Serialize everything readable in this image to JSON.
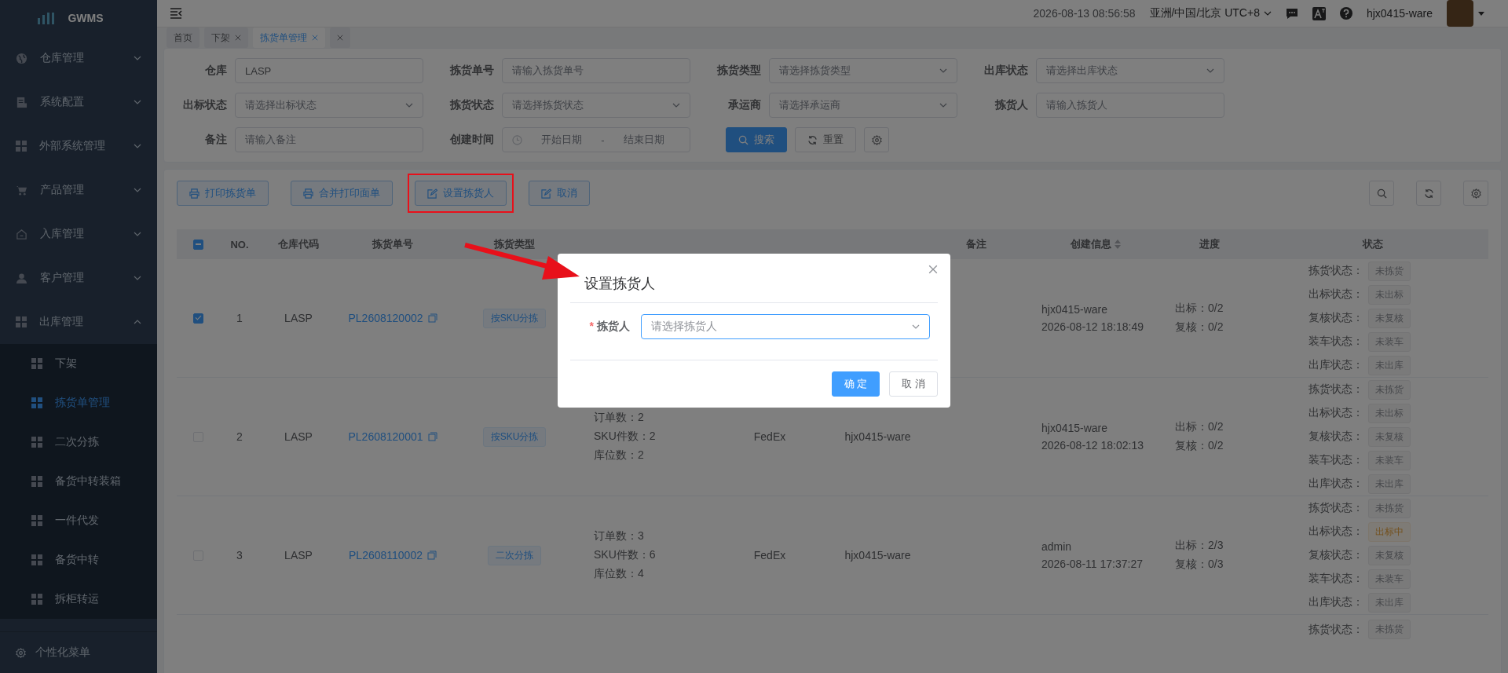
{
  "sidebar": {
    "logo": "GWMS",
    "items": [
      {
        "label": "仓库管理",
        "expanded": false
      },
      {
        "label": "系统配置",
        "expanded": false
      },
      {
        "label": "外部系统管理",
        "expanded": false
      },
      {
        "label": "产品管理",
        "expanded": false
      },
      {
        "label": "入库管理",
        "expanded": false
      },
      {
        "label": "客户管理",
        "expanded": false
      },
      {
        "label": "出库管理",
        "expanded": true,
        "children": [
          {
            "label": "下架",
            "selected": false
          },
          {
            "label": "拣货单管理",
            "selected": true
          },
          {
            "label": "二次分拣",
            "selected": false
          },
          {
            "label": "备货中转装箱",
            "selected": false
          },
          {
            "label": "一件代发",
            "selected": false
          },
          {
            "label": "备货中转",
            "selected": false
          },
          {
            "label": "拆柜转运",
            "selected": false
          }
        ]
      }
    ],
    "footer": "个性化菜单"
  },
  "header": {
    "datetime": "2026-08-13 08:56:58",
    "timezone": "亚洲/中国/北京 UTC+8",
    "user": "hjx0415-ware"
  },
  "tabs": [
    {
      "label": "首页",
      "closable": false,
      "selected": false
    },
    {
      "label": "下架",
      "closable": true,
      "selected": false
    },
    {
      "label": "拣货单管理",
      "closable": true,
      "selected": true
    },
    {
      "closable": true,
      "selected": false
    }
  ],
  "filters": [
    {
      "label": "仓库",
      "kind": "text",
      "value": "LASP"
    },
    {
      "label": "拣货单号",
      "kind": "text",
      "placeholder": "请输入拣货单号"
    },
    {
      "label": "拣货类型",
      "kind": "select",
      "placeholder": "请选择拣货类型"
    },
    {
      "label": "出库状态",
      "kind": "select",
      "placeholder": "请选择出库状态"
    },
    {
      "label": "出标状态",
      "kind": "select",
      "placeholder": "请选择出标状态"
    },
    {
      "label": "拣货状态",
      "kind": "select",
      "placeholder": "请选择拣货状态"
    },
    {
      "label": "承运商",
      "kind": "select",
      "placeholder": "请选择承运商"
    },
    {
      "label": "拣货人",
      "kind": "text",
      "placeholder": "请输入拣货人"
    },
    {
      "label": "备注",
      "kind": "text",
      "placeholder": "请输入备注"
    },
    {
      "label": "创建时间",
      "kind": "daterange",
      "start_placeholder": "开始日期",
      "separator": "-",
      "end_placeholder": "结束日期"
    }
  ],
  "filter_buttons": {
    "search": "搜索",
    "reset": "重置"
  },
  "toolbar": [
    {
      "label": "打印拣货单",
      "kind": "print",
      "annotated": false
    },
    {
      "label": "合并打印面单",
      "kind": "print",
      "annotated": false
    },
    {
      "label": "设置拣货人",
      "kind": "edit",
      "annotated": true
    },
    {
      "label": "取消",
      "kind": "edit",
      "annotated": false
    }
  ],
  "table": {
    "select_all_indeterminate": true,
    "columns": {
      "no": "NO.",
      "warehouse_code": "仓库代码",
      "pick_no": "拣货单号",
      "pick_type": "拣货类型",
      "remark": "备注",
      "created": "创建信息",
      "progress": "进度",
      "status": "状态"
    },
    "rows": [
      {
        "checked": true,
        "no": "1",
        "warehouse_code": "LASP",
        "pick_no": "PL2608120002",
        "pick_type": "按SKU分拣",
        "created_by": "hjx0415-ware",
        "created_at": "2026-08-12 18:18:49",
        "progress": [
          "出标：0/2",
          "复核：0/2"
        ],
        "statuses": [
          {
            "label": "拣货状态：",
            "value": "未拣货",
            "kind": "default"
          },
          {
            "label": "出标状态：",
            "value": "未出标",
            "kind": "default"
          },
          {
            "label": "复核状态：",
            "value": "未复核",
            "kind": "default"
          },
          {
            "label": "装车状态：",
            "value": "未装车",
            "kind": "default"
          },
          {
            "label": "出库状态：",
            "value": "未出库",
            "kind": "default"
          }
        ]
      },
      {
        "checked": false,
        "no": "2",
        "warehouse_code": "LASP",
        "pick_no": "PL2608120001",
        "pick_type": "按SKU分拣",
        "column_6": [
          "订单数：2",
          "SKU件数：2",
          "库位数：2"
        ],
        "column_7": "FedEx",
        "column_8": "hjx0415-ware",
        "created_by": "hjx0415-ware",
        "created_at": "2026-08-12 18:02:13",
        "progress": [
          "出标：0/2",
          "复核：0/2"
        ],
        "statuses": [
          {
            "label": "拣货状态：",
            "value": "未拣货",
            "kind": "default"
          },
          {
            "label": "出标状态：",
            "value": "未出标",
            "kind": "default"
          },
          {
            "label": "复核状态：",
            "value": "未复核",
            "kind": "default"
          },
          {
            "label": "装车状态：",
            "value": "未装车",
            "kind": "default"
          },
          {
            "label": "出库状态：",
            "value": "未出库",
            "kind": "default"
          }
        ]
      },
      {
        "checked": false,
        "no": "3",
        "warehouse_code": "LASP",
        "pick_no": "PL2608110002",
        "pick_type": "二次分拣",
        "column_6": [
          "订单数：3",
          "SKU件数：6",
          "库位数：4"
        ],
        "column_7": "FedEx",
        "column_8": "hjx0415-ware",
        "created_by": "admin",
        "created_at": "2026-08-11 17:37:27",
        "progress": [
          "出标：2/3",
          "复核：0/3"
        ],
        "statuses": [
          {
            "label": "拣货状态：",
            "value": "未拣货",
            "kind": "default"
          },
          {
            "label": "出标状态：",
            "value": "出标中",
            "kind": "warning"
          },
          {
            "label": "复核状态：",
            "value": "未复核",
            "kind": "default"
          },
          {
            "label": "装车状态：",
            "value": "未装车",
            "kind": "default"
          },
          {
            "label": "出库状态：",
            "value": "未出库",
            "kind": "default"
          }
        ]
      },
      {
        "statuses": [
          {
            "label": "拣货状态：",
            "value": "未拣货",
            "kind": "default"
          }
        ]
      }
    ]
  },
  "modal": {
    "title": "设置拣货人",
    "field_label": "拣货人",
    "required_mark": "*",
    "placeholder": "请选择拣货人",
    "confirm": "确 定",
    "cancel": "取 消"
  }
}
